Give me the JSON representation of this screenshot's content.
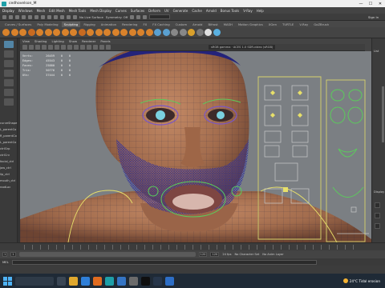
{
  "window": {
    "title": "cedhovelson_M"
  },
  "window_controls": [
    "—",
    "☐",
    "✕"
  ],
  "menubar": {
    "items": [
      "Display",
      "Windows",
      "Mesh",
      "Edit Mesh",
      "Mesh Tools",
      "Mesh Display",
      "Curves",
      "Surfaces",
      "Deform",
      "UV",
      "Generate",
      "Cache",
      "Arnold",
      "Bonus Tools",
      "V-Ray",
      "Arnold",
      "Help"
    ]
  },
  "statusline": {
    "field_label": "No Live Surface",
    "symmetry": "Symmetry: Off",
    "sign_in": "Sign In"
  },
  "shelf_tabs": {
    "items": [
      "Curves / Surfaces",
      "Poly Modeling",
      "Sculpting",
      "Rigging",
      "Animation",
      "Rendering",
      "FX",
      "FX Caching",
      "Custom",
      "Arnold",
      "Bifrost",
      "MASH",
      "Motion Graphics",
      "XGen",
      "TURTLE",
      "V-Ray",
      "GoZBrush"
    ],
    "active_index": 2
  },
  "viewport_menu": {
    "items": [
      "View",
      "Shading",
      "Lighting",
      "Show",
      "Renderer",
      "Panels"
    ]
  },
  "viewport_toolbar": {
    "coords": "sRGB gamma · ACES 1.0 SDR-video (sRGB)"
  },
  "hud": {
    "rows": [
      {
        "label": "Verts:",
        "v1": "26459",
        "v2": "0",
        "v3": "0"
      },
      {
        "label": "Edges:",
        "v1": "45543",
        "v2": "0",
        "v3": "0"
      },
      {
        "label": "Faces:",
        "v1": "25880",
        "v2": "0",
        "v3": "0"
      },
      {
        "label": "Tris:",
        "v1": "50776",
        "v2": "0",
        "v3": "0"
      },
      {
        "label": "UVs:",
        "v1": "37444",
        "v2": "0",
        "v3": "0"
      }
    ]
  },
  "left_panel": {
    "labels": [
      "curveShape",
      "L_parentCo",
      "R_parentCo",
      "L_parentCo",
      "ctrlGrp",
      "ctrlCrv",
      "facial_ctrl",
      "jaw_ctrl",
      "lip_ctrl",
      "mouth_ctrl",
      "rootLoc"
    ]
  },
  "right_panel": {
    "label_top": "List",
    "label_bottom": "Display"
  },
  "range": {
    "start": "1",
    "end": "120",
    "no_char_set": "No Character Set",
    "no_anim_layer": "No Anim Layer",
    "fps": "24 fps"
  },
  "command_line": {
    "label": "MEL"
  },
  "taskbar": {
    "weather": "24°C  Tidal erosion",
    "time": ""
  },
  "colors": {
    "accent": "#5285a6",
    "mesh_wire": "#3a3aa8",
    "skin": "#b07a5a",
    "rig_yellow": "#e8e06a",
    "rig_green": "#4ecf4e"
  }
}
